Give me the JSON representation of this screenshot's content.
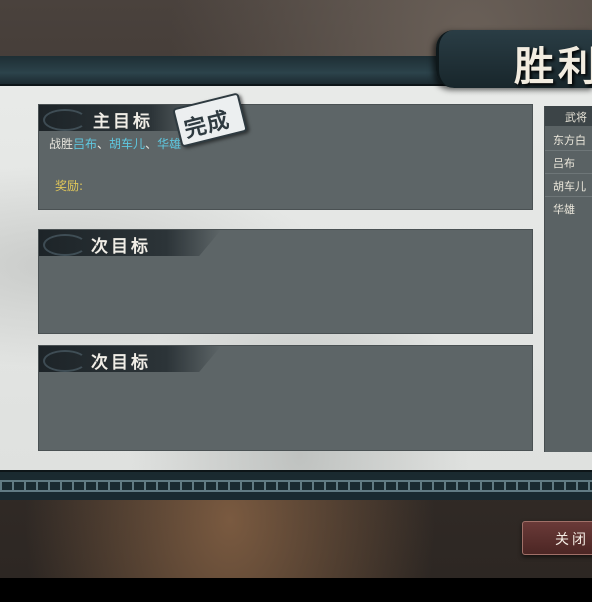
{
  "screen_title": "胜利",
  "title_visible": "胜利",
  "objectives": [
    {
      "heading": "主目标",
      "text_prefix": "战胜",
      "targets": [
        "吕布",
        "胡车儿",
        "华雄"
      ],
      "separator": "、",
      "suffix": "",
      "reward_label": "奖励:",
      "status_stamp": "完成"
    },
    {
      "heading": "次目标"
    },
    {
      "heading": "次目标"
    }
  ],
  "generals_panel": {
    "header": "武将",
    "rows": [
      "东方白",
      "吕布",
      "胡车儿",
      "华雄"
    ]
  },
  "close_button": {
    "label": "关闭"
  },
  "colors": {
    "target_name": "#5ec8e0",
    "reward_label": "#e0c75a",
    "objective_box": "#5d6567",
    "close_button": "#5a302e"
  }
}
